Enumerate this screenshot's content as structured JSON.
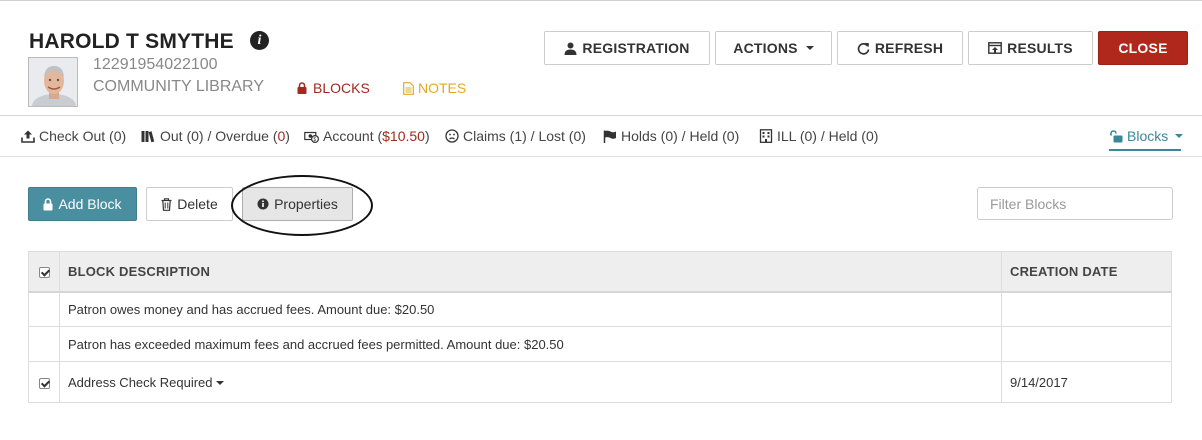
{
  "patron": {
    "name": "HAROLD T SMYTHE",
    "barcode": "12291954022100",
    "library": "COMMUNITY LIBRARY",
    "blocks_label": "BLOCKS",
    "notes_label": "NOTES"
  },
  "header_buttons": {
    "registration": "REGISTRATION",
    "actions": "ACTIONS",
    "refresh": "REFRESH",
    "results": "RESULTS",
    "close": "CLOSE"
  },
  "nav": {
    "checkout": "Check Out (0)",
    "out_prefix": "Out (0) / Overdue (",
    "out_overdue": "0",
    "out_suffix": ")",
    "account_prefix": "Account (",
    "account_amount": "$10.50",
    "account_suffix": ")",
    "claims": "Claims (1) / Lost (0)",
    "holds": "Holds (0) / Held (0)",
    "ill": "ILL (0) / Held (0)",
    "blocks": "Blocks"
  },
  "toolbar": {
    "add_block": "Add Block",
    "delete": "Delete",
    "properties": "Properties",
    "filter_placeholder": "Filter Blocks"
  },
  "table": {
    "headers": {
      "description": "BLOCK DESCRIPTION",
      "creation_date": "CREATION DATE"
    },
    "rows": [
      {
        "description": "Patron owes money and has accrued fees. Amount due: $20.50",
        "date": "",
        "checked": false
      },
      {
        "description": "Patron has exceeded maximum fees and accrued fees permitted. Amount due: $20.50",
        "date": "",
        "checked": false
      },
      {
        "description": "Address Check Required",
        "date": "9/14/2017",
        "checked": true
      }
    ]
  },
  "colors": {
    "close_red": "#b0281c",
    "blocks_red": "#a12a20",
    "notes_yellow": "#e3a827",
    "teal": "#4a8fa0"
  }
}
